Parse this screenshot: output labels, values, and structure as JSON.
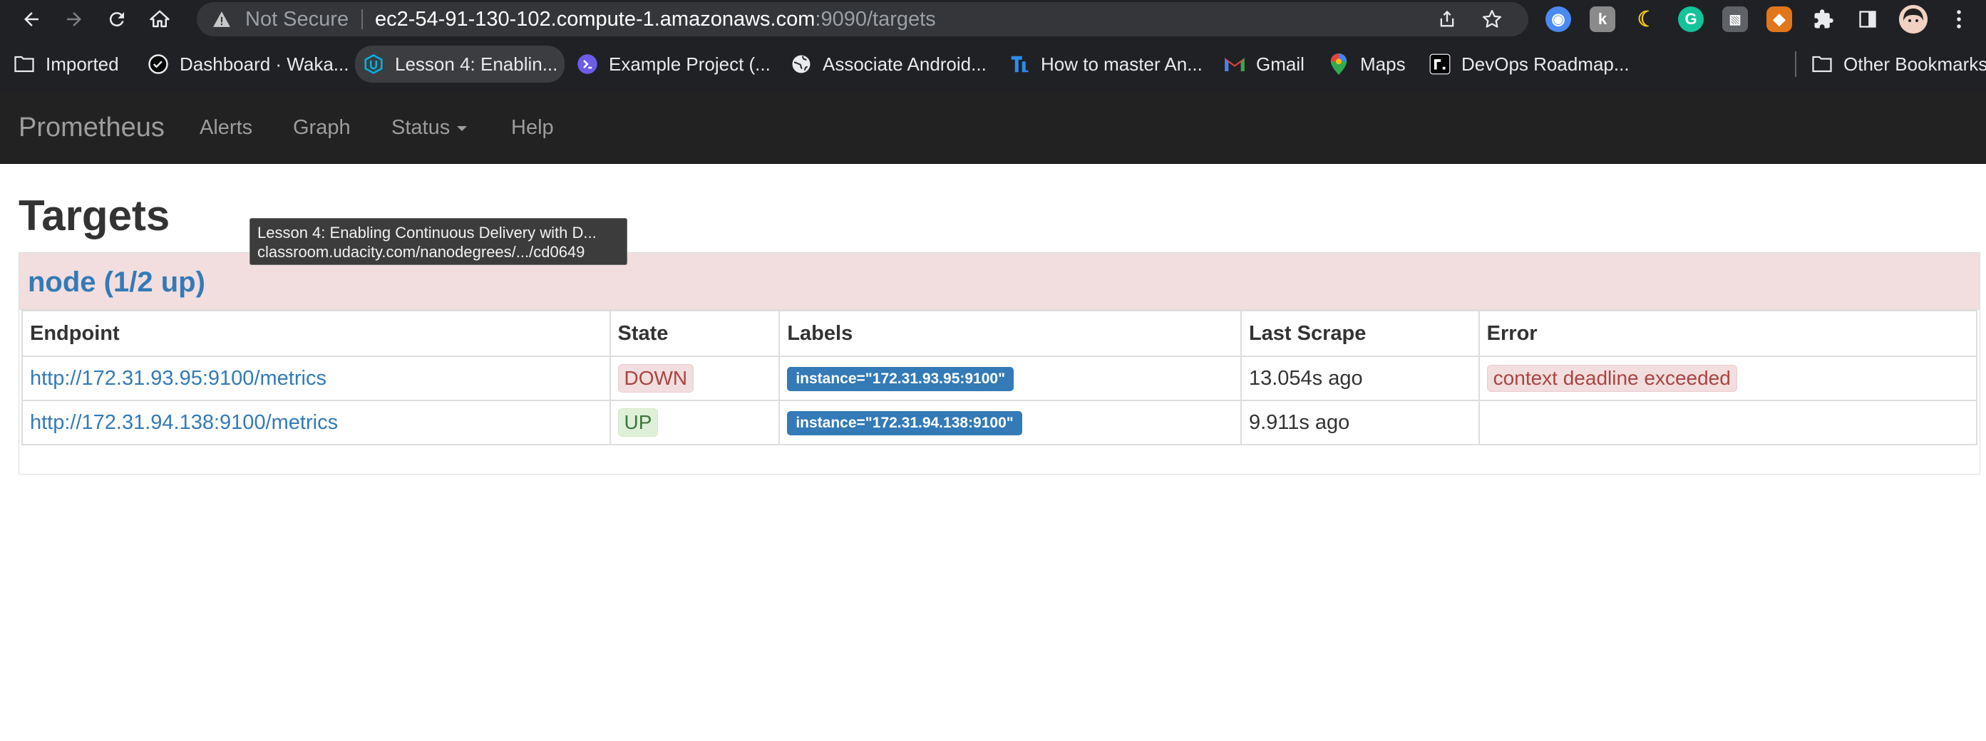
{
  "browser": {
    "omnibox": {
      "security_text": "Not Secure",
      "url_host": "ec2-54-91-130-102.compute-1.amazonaws.com",
      "url_rest": ":9090/targets"
    },
    "nav_icons": [
      "back-icon",
      "forward-icon",
      "reload-icon",
      "home-icon"
    ],
    "extensions": [
      {
        "name": "compass-extension-icon",
        "color": "#4a8af4"
      },
      {
        "name": "k-extension-icon",
        "color": "#8a8a8a"
      },
      {
        "name": "moon-extension-icon",
        "color": "#f5c518"
      },
      {
        "name": "grammarly-extension-icon",
        "color": "#15c39a"
      },
      {
        "name": "image-extension-icon",
        "color": "#9aa0a6"
      },
      {
        "name": "metamask-extension-icon",
        "color": "#e2761b"
      },
      {
        "name": "puzzle-extensions-icon",
        "color": "#e8eaed"
      },
      {
        "name": "sidebar-icon",
        "color": "#e8eaed"
      },
      {
        "name": "profile-avatar",
        "color": "#f1d1c2"
      },
      {
        "name": "menu-kebab-icon",
        "color": "#e8eaed"
      }
    ],
    "bookmarks": [
      {
        "label": "Imported",
        "icon": "folder-icon"
      },
      {
        "label": "Dashboard · Waka...",
        "icon": "wakatime-icon"
      },
      {
        "label": "Lesson 4: Enablin...",
        "icon": "udacity-icon"
      },
      {
        "label": "Example Project (...",
        "icon": "project-icon"
      },
      {
        "label": "Associate Android...",
        "icon": "globe-icon"
      },
      {
        "label": "How to master An...",
        "icon": "tl-icon"
      },
      {
        "label": "Gmail",
        "icon": "gmail-icon"
      },
      {
        "label": "Maps",
        "icon": "maps-icon"
      },
      {
        "label": "DevOps Roadmap...",
        "icon": "roadmap-icon"
      }
    ],
    "other_bookmarks": "Other Bookmarks"
  },
  "prom_nav": {
    "brand": "Prometheus",
    "alerts": "Alerts",
    "graph": "Graph",
    "status": "Status",
    "help": "Help"
  },
  "page": {
    "title": "Targets",
    "job": {
      "title": "node (1/2 up)",
      "columns": [
        "Endpoint",
        "State",
        "Labels",
        "Last Scrape",
        "Error"
      ],
      "rows": [
        {
          "endpoint": "http://172.31.93.95:9100/metrics",
          "state": "DOWN",
          "label": "instance=\"172.31.93.95:9100\"",
          "last_scrape": "13.054s ago",
          "error": "context deadline exceeded"
        },
        {
          "endpoint": "http://172.31.94.138:9100/metrics",
          "state": "UP",
          "label": "instance=\"172.31.94.138:9100\"",
          "last_scrape": "9.911s ago",
          "error": ""
        }
      ]
    }
  },
  "tooltip": {
    "line1": "Lesson 4: Enabling Continuous Delivery with D...",
    "line2": "classroom.udacity.com/nanodegrees/.../cd0649"
  }
}
